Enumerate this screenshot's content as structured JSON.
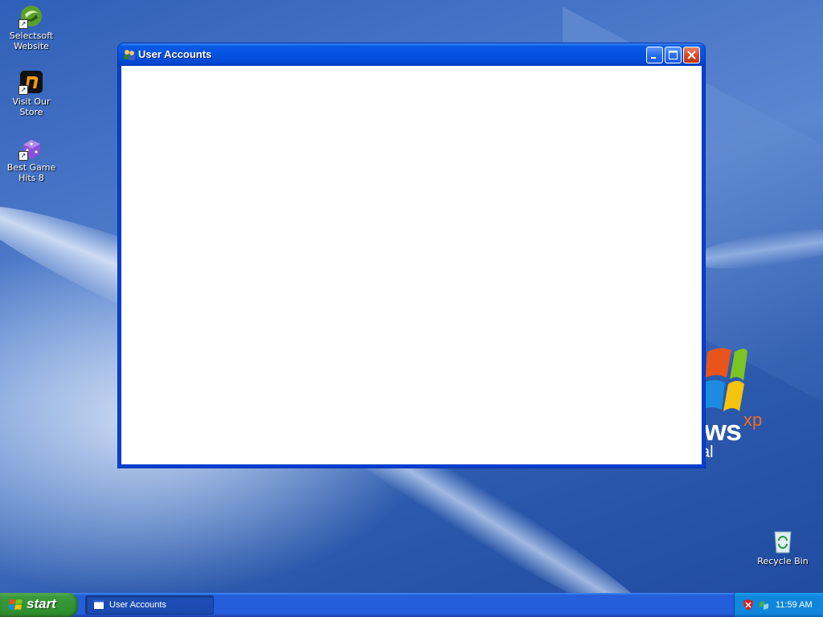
{
  "desktop": {
    "icons": [
      {
        "label": "Selectsoft Website"
      },
      {
        "label": "Visit Our Store"
      },
      {
        "label": "Best Game Hits 8"
      },
      {
        "label": "Recycle Bin"
      }
    ],
    "wallpaper_logo": {
      "text": "ws",
      "sup": "xp",
      "sub": "al"
    }
  },
  "window": {
    "title": "User Accounts",
    "icon": "user-accounts-icon",
    "controls": {
      "minimize": "minimize-icon",
      "maximize": "maximize-icon",
      "close": "close-icon"
    }
  },
  "taskbar": {
    "start_label": "start",
    "tasks": [
      {
        "label": "User Accounts",
        "icon": "window-icon"
      }
    ],
    "tray": {
      "clock": "11:59 AM",
      "icons": [
        "security-shield-icon",
        "network-icon"
      ]
    }
  },
  "colors": {
    "title_bar": "#0453e0",
    "taskbar": "#245edb",
    "start_button": "#3c9a3c",
    "tray": "#0f86dc",
    "close_button": "#d94a28"
  }
}
